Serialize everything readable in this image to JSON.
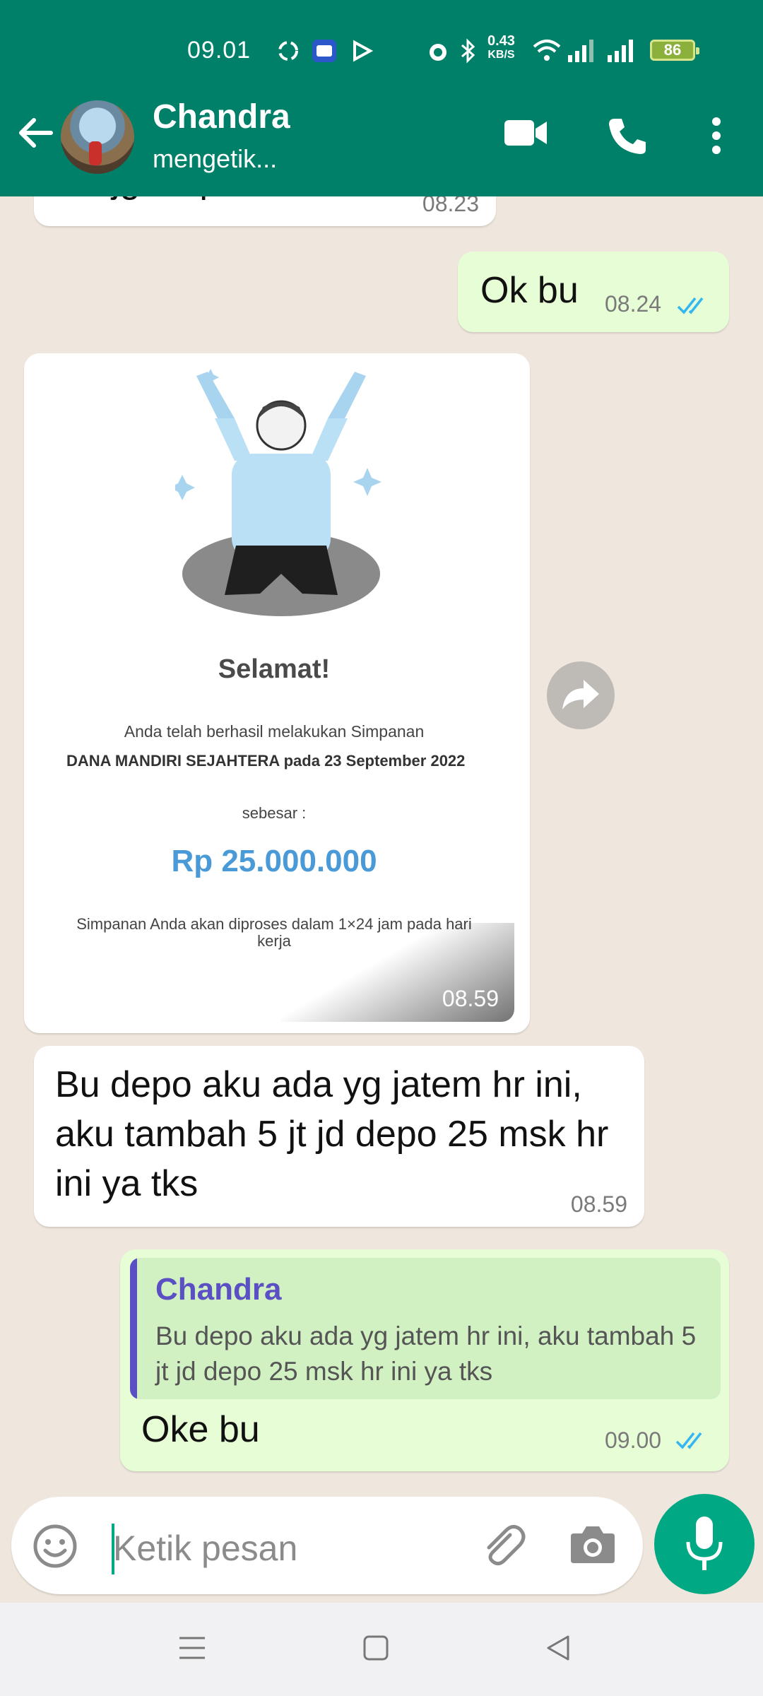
{
  "status_bar": {
    "time": "09.01",
    "net_speed_value": "0.43",
    "net_speed_unit": "KB/S",
    "battery": "86"
  },
  "header": {
    "contact_name": "Chandra",
    "contact_status": "mengetik..."
  },
  "messages": [
    {
      "id": "m0",
      "direction": "in",
      "text": "Bu jgn lupa th tks",
      "time": "08.23"
    },
    {
      "id": "m1",
      "direction": "out",
      "text": "Ok bu",
      "time": "08.24"
    },
    {
      "id": "m2",
      "direction": "in",
      "type": "image",
      "time": "08.59",
      "image": {
        "title": "Selamat!",
        "line1": "Anda telah berhasil melakukan Simpanan",
        "line2": "DANA MANDIRI SEJAHTERA pada 23 September 2022",
        "line3": "sebesar :",
        "amount": "Rp 25.000.000",
        "note": "Simpanan Anda akan diproses dalam 1×24 jam pada hari kerja"
      }
    },
    {
      "id": "m3",
      "direction": "in",
      "text": "Bu depo aku ada yg jatem hr ini, aku tambah 5 jt jd depo 25 msk hr ini ya tks",
      "time": "08.59"
    },
    {
      "id": "m4",
      "direction": "out",
      "text": "Oke bu",
      "time": "09.00",
      "quote": {
        "name": "Chandra",
        "text": "Bu depo aku ada yg jatem hr ini, aku tambah 5 jt jd depo 25 msk hr ini ya tks"
      }
    }
  ],
  "input": {
    "placeholder": "Ketik pesan"
  },
  "colors": {
    "header": "#008069",
    "accent": "#00a884",
    "outgoing": "#e7fdd5",
    "tick_read": "#34b7f1"
  },
  "icons": [
    "back-arrow-icon",
    "video-call-icon",
    "phone-icon",
    "more-icon",
    "emoji-icon",
    "attach-icon",
    "camera-icon",
    "mic-icon",
    "forward-icon"
  ]
}
